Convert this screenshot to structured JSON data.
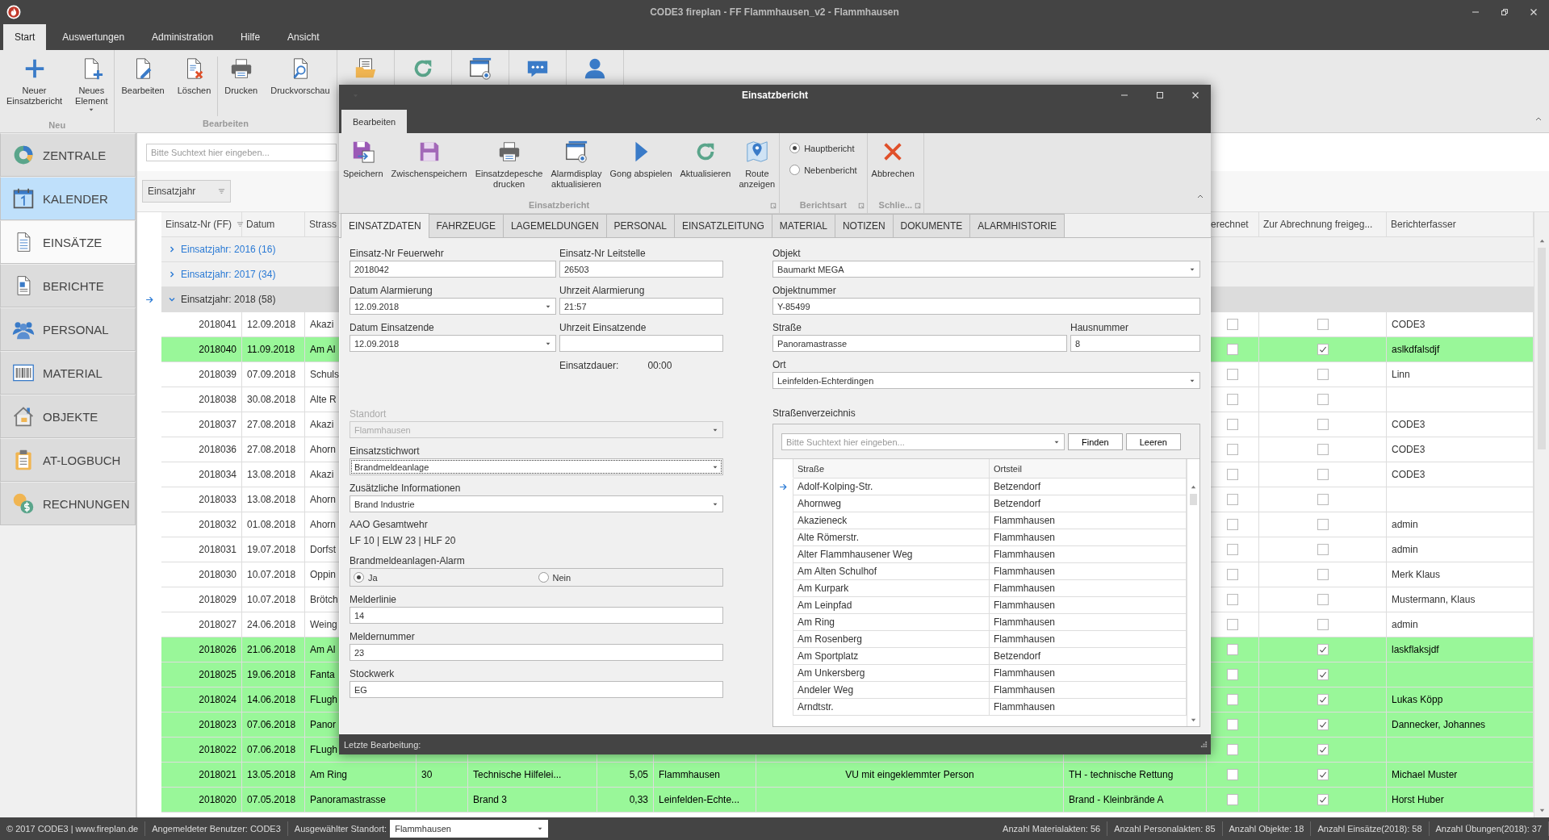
{
  "window": {
    "title": "CODE3 fireplan - FF Flammhausen_v2 - Flammhausen"
  },
  "menu_tabs": [
    {
      "label": "Start",
      "selected": true
    },
    {
      "label": "Auswertungen",
      "selected": false
    },
    {
      "label": "Administration",
      "selected": false
    },
    {
      "label": "Hilfe",
      "selected": false
    },
    {
      "label": "Ansicht",
      "selected": false
    }
  ],
  "ribbon": {
    "groups": [
      {
        "label": "Neu",
        "buttons": [
          {
            "label": "Neuer\nEinsatzbericht",
            "dropdown": false,
            "separator": false
          },
          {
            "label": "Neues\nElement",
            "dropdown": true,
            "separator": false
          }
        ]
      },
      {
        "label": "Bearbeiten",
        "buttons": [
          {
            "label": "Bearbeiten",
            "dropdown": false,
            "separator": false
          },
          {
            "label": "Löschen",
            "dropdown": false,
            "separator": false
          },
          {
            "label": "Drucken",
            "dropdown": false,
            "separator": true
          },
          {
            "label": "Druckvorschau",
            "dropdown": false,
            "separator": false
          }
        ]
      }
    ]
  },
  "sidebar": {
    "items": [
      {
        "label": "ZENTRALE",
        "selected": false,
        "hovered": false
      },
      {
        "label": "KALENDER",
        "selected": true,
        "hovered": false
      },
      {
        "label": "EINSÄTZE",
        "selected": false,
        "hovered": true
      },
      {
        "label": "BERICHTE",
        "selected": false,
        "hovered": false
      },
      {
        "label": "PERSONAL",
        "selected": false,
        "hovered": false
      },
      {
        "label": "MATERIAL",
        "selected": false,
        "hovered": false
      },
      {
        "label": "OBJEKTE",
        "selected": false,
        "hovered": false
      },
      {
        "label": "AT-LOGBUCH",
        "selected": false,
        "hovered": false
      },
      {
        "label": "RECHNUNGEN",
        "selected": false,
        "hovered": false
      }
    ]
  },
  "search": {
    "placeholder": "Bitte Suchtext hier eingeben..."
  },
  "group_panel": {
    "chip": "Einsatzjahr"
  },
  "table": {
    "columns": [
      "Einsatz-Nr (FF)",
      "Datum",
      "Strass"
    ],
    "right_columns": [
      "erechnet",
      "Zur Abrechnung freigeg...",
      "Berichterfasser"
    ],
    "groups": [
      {
        "label": "Einsatzjahr: 2016 (16)",
        "expanded": false,
        "current": false
      },
      {
        "label": "Einsatzjahr: 2017 (34)",
        "expanded": false,
        "current": false
      },
      {
        "label": "Einsatzjahr: 2018 (58)",
        "expanded": true,
        "current": true
      }
    ],
    "rows": [
      {
        "nr": "2018041",
        "datum": "12.09.2018",
        "strasse": "Akazi",
        "erechnet": false,
        "freigegeben": false,
        "berichterfasser": "CODE3"
      },
      {
        "nr": "2018040",
        "datum": "11.09.2018",
        "strasse": "Am Al",
        "erechnet": false,
        "freigegeben": true,
        "berichterfasser": "aslkdfalsdjf"
      },
      {
        "nr": "2018039",
        "datum": "07.09.2018",
        "strasse": "Schuls",
        "erechnet": false,
        "freigegeben": false,
        "berichterfasser": "Linn"
      },
      {
        "nr": "2018038",
        "datum": "30.08.2018",
        "strasse": "Alte R",
        "erechnet": false,
        "freigegeben": false
      },
      {
        "nr": "2018037",
        "datum": "27.08.2018",
        "strasse": "Akazi",
        "erechnet": false,
        "freigegeben": false,
        "berichterfasser": "CODE3"
      },
      {
        "nr": "2018036",
        "datum": "27.08.2018",
        "strasse": "Ahorn",
        "erechnet": false,
        "freigegeben": false,
        "berichterfasser": "CODE3"
      },
      {
        "nr": "2018034",
        "datum": "13.08.2018",
        "strasse": "Akazi",
        "erechnet": false,
        "freigegeben": false,
        "berichterfasser": "CODE3"
      },
      {
        "nr": "2018033",
        "datum": "13.08.2018",
        "strasse": "Ahorn",
        "erechnet": false,
        "freigegeben": false
      },
      {
        "nr": "2018032",
        "datum": "01.08.2018",
        "strasse": "Ahorn",
        "erechnet": false,
        "freigegeben": false,
        "berichterfasser": "admin"
      },
      {
        "nr": "2018031",
        "datum": "19.07.2018",
        "strasse": "Dorfst",
        "erechnet": false,
        "freigegeben": false,
        "berichterfasser": "admin"
      },
      {
        "nr": "2018030",
        "datum": "10.07.2018",
        "strasse": "Oppin",
        "erechnet": false,
        "freigegeben": false,
        "berichterfasser": "Merk Klaus"
      },
      {
        "nr": "2018029",
        "datum": "10.07.2018",
        "strasse": "Brötch",
        "erechnet": false,
        "freigegeben": false,
        "berichterfasser": "Mustermann, Klaus"
      },
      {
        "nr": "2018027",
        "datum": "24.06.2018",
        "strasse": "Weing",
        "erechnet": false,
        "freigegeben": false,
        "berichterfasser": "admin"
      },
      {
        "nr": "2018026",
        "datum": "21.06.2018",
        "strasse": "Am Al",
        "erechnet": false,
        "freigegeben": true,
        "berichterfasser": "laskflaksjdf"
      },
      {
        "nr": "2018025",
        "datum": "19.06.2018",
        "strasse": "Fanta",
        "erechnet": false,
        "freigegeben": true
      },
      {
        "nr": "2018024",
        "datum": "14.06.2018",
        "strasse": "FLugh",
        "erechnet": false,
        "freigegeben": true,
        "berichterfasser": "Lukas Köpp"
      },
      {
        "nr": "2018023",
        "datum": "07.06.2018",
        "strasse": "Panor",
        "erechnet": false,
        "freigegeben": true,
        "berichterfasser": "Dannecker, Johannes"
      },
      {
        "nr": "2018022",
        "datum": "07.06.2018",
        "strasse": "FLugh",
        "erechnet": false,
        "freigegeben": true
      },
      {
        "nr": "2018021",
        "datum": "13.05.2018",
        "strasse": "Am Ring",
        "column_4": "30",
        "column_5": "Technische Hilfelei...",
        "column_6": "5,05",
        "column_7": "Flammhausen",
        "column_8": "VU mit eingeklemmter Person",
        "column_9": "TH - technische Rettung",
        "erechnet": false,
        "freigegeben": true,
        "berichterfasser": "Michael Muster"
      },
      {
        "nr": "2018020",
        "datum": "07.05.2018",
        "strasse": "Panoramastrasse",
        "column_5": "Brand 3",
        "column_6": "0,33",
        "column_7": "Leinfelden-Echte...",
        "column_9": "Brand - Kleinbrände A",
        "erechnet": false,
        "freigegeben": true,
        "berichterfasser": "Horst Huber"
      }
    ]
  },
  "dialog": {
    "title": "Einsatzbericht",
    "ribbon_tab": "Bearbeiten",
    "groups": [
      {
        "kind": "buttons",
        "label": "Einsatzbericht",
        "buttons": [
          "Speichern",
          "Zwischenspeichern",
          "Einsatzdepesche\ndrucken",
          "Alarmdisplay\naktualisieren",
          "Gong abspielen",
          "Aktualisieren",
          "Route\nanzeigen"
        ]
      },
      {
        "kind": "radios",
        "label": "Berichtsart",
        "options": [
          {
            "label": "Hauptbericht",
            "selected": true
          },
          {
            "label": "Nebenbericht",
            "selected": false
          }
        ]
      },
      {
        "kind": "buttons",
        "label": "Schlie...",
        "buttons": [
          "Abbrechen"
        ]
      }
    ],
    "tabs": [
      {
        "label": "EINSATZDATEN",
        "selected": true
      },
      {
        "label": "FAHRZEUGE",
        "selected": false
      },
      {
        "label": "LAGEMELDUNGEN",
        "selected": false
      },
      {
        "label": "PERSONAL",
        "selected": false
      },
      {
        "label": "EINSATZLEITUNG",
        "selected": false
      },
      {
        "label": "MATERIAL",
        "selected": false
      },
      {
        "label": "NOTIZEN",
        "selected": false
      },
      {
        "label": "DOKUMENTE",
        "selected": false
      },
      {
        "label": "ALARMHISTORIE",
        "selected": false
      }
    ],
    "left": [
      {
        "kind": "fields",
        "fields": [
          {
            "label": "Einsatz-Nr Feuerwehr",
            "value": "2018042",
            "kind": "text",
            "disabled": false,
            "focused": false
          },
          {
            "label": "Einsatz-Nr Leitstelle",
            "value": "26503",
            "kind": "text",
            "disabled": false,
            "focused": false
          }
        ]
      },
      {
        "kind": "fields",
        "fields": [
          {
            "label": "Datum Alarmierung",
            "value": "12.09.2018",
            "kind": "dropdown",
            "disabled": false,
            "focused": false
          },
          {
            "label": "Uhrzeit Alarmierung",
            "value": "21:57",
            "kind": "text",
            "disabled": false,
            "focused": false
          }
        ]
      },
      {
        "kind": "fields",
        "fields": [
          {
            "label": "Datum Einsatzende",
            "value": "12.09.2018",
            "kind": "dropdown",
            "disabled": false,
            "focused": false
          },
          {
            "label": "Uhrzeit Einsatzende",
            "kind": "text",
            "disabled": false,
            "focused": false
          }
        ]
      },
      {
        "kind": "duration",
        "label": "Einsatzdauer:",
        "value": "00:00"
      },
      {
        "kind": "fields",
        "fields": [
          {
            "label": "Standort",
            "value": "Flammhausen",
            "kind": "dropdown",
            "disabled": true,
            "focused": false
          }
        ]
      },
      {
        "kind": "fields",
        "fields": [
          {
            "label": "Einsatzstichwort",
            "value": "Brandmeldeanlage",
            "kind": "dropdown",
            "disabled": false,
            "focused": true
          }
        ]
      },
      {
        "kind": "fields",
        "fields": [
          {
            "label": "Zusätzliche Informationen",
            "value": "Brand Industrie",
            "kind": "dropdown",
            "disabled": false,
            "focused": false
          }
        ]
      },
      {
        "kind": "static",
        "label": "AAO Gesamtwehr",
        "value": "LF 10 | ELW 23 | HLF 20"
      },
      {
        "kind": "radio",
        "label": "Brandmeldeanlagen-Alarm",
        "options": [
          {
            "label": "Ja",
            "selected": true
          },
          {
            "label": "Nein",
            "selected": false
          }
        ]
      },
      {
        "kind": "fields",
        "fields": [
          {
            "label": "Melderlinie",
            "value": "14",
            "kind": "text",
            "disabled": false,
            "focused": false
          }
        ]
      },
      {
        "kind": "fields",
        "fields": [
          {
            "label": "Meldernummer",
            "value": "23",
            "kind": "text",
            "disabled": false,
            "focused": false
          }
        ]
      },
      {
        "kind": "fields",
        "fields": [
          {
            "label": "Stockwerk",
            "value": "EG",
            "kind": "text",
            "disabled": false,
            "focused": false
          }
        ]
      }
    ],
    "right": [
      {
        "kind": "fields",
        "fields": [
          {
            "label": "Objekt",
            "value": "Baumarkt MEGA",
            "kind": "dropdown",
            "disabled": false,
            "focused": false
          }
        ]
      },
      {
        "kind": "fields",
        "fields": [
          {
            "label": "Objektnummer",
            "value": "Y-85499",
            "kind": "text",
            "disabled": false,
            "focused": false
          }
        ]
      },
      {
        "kind": "fields",
        "fields": [
          {
            "label": "Straße",
            "value": "Panoramastrasse",
            "kind": "text",
            "disabled": false,
            "focused": false
          },
          {
            "label": "Hausnummer",
            "value": "8",
            "kind": "text",
            "disabled": false,
            "focused": false
          }
        ]
      },
      {
        "kind": "fields",
        "fields": [
          {
            "label": "Ort",
            "value": "Leinfelden-Echterdingen",
            "kind": "dropdown",
            "disabled": false,
            "focused": false
          }
        ]
      }
    ],
    "street_directory": {
      "label": "Straßenverzeichnis",
      "placeholder": "Bitte Suchtext hier eingeben...",
      "buttons": [
        "Finden",
        "Leeren"
      ],
      "columns": [
        "Straße",
        "Ortsteil"
      ],
      "rows": [
        {
          "strasse": "Adolf-Kolping-Str.",
          "ortsteil": "Betzendorf",
          "current": true
        },
        {
          "strasse": "Ahornweg",
          "ortsteil": "Betzendorf",
          "current": false
        },
        {
          "strasse": "Akazieneck",
          "ortsteil": "Flammhausen",
          "current": false
        },
        {
          "strasse": "Alte Römerstr.",
          "ortsteil": "Flammhausen",
          "current": false
        },
        {
          "strasse": "Alter Flammhausener Weg",
          "ortsteil": "Flammhausen",
          "current": false
        },
        {
          "strasse": "Am Alten Schulhof",
          "ortsteil": "Flammhausen",
          "current": false
        },
        {
          "strasse": "Am Kurpark",
          "ortsteil": "Flammhausen",
          "current": false
        },
        {
          "strasse": "Am Leinpfad",
          "ortsteil": "Flammhausen",
          "current": false
        },
        {
          "strasse": "Am Ring",
          "ortsteil": "Flammhausen",
          "current": false
        },
        {
          "strasse": "Am Rosenberg",
          "ortsteil": "Flammhausen",
          "current": false
        },
        {
          "strasse": "Am Sportplatz",
          "ortsteil": "Betzendorf",
          "current": false
        },
        {
          "strasse": "Am Unkersberg",
          "ortsteil": "Flammhausen",
          "current": false
        },
        {
          "strasse": "Andeler Weg",
          "ortsteil": "Flammhausen",
          "current": false
        },
        {
          "strasse": "Arndtstr.",
          "ortsteil": "Flammhausen",
          "current": false
        }
      ]
    },
    "footer": "Letzte Bearbeitung:"
  },
  "status_bar": {
    "copyright": "© 2017 CODE3 | www.fireplan.de",
    "user": "Angemeldeter Benutzer: CODE3",
    "location_label": "Ausgewählter Standort:",
    "location": "Flammhausen",
    "counts": [
      "Anzahl Materialakten: 56",
      "Anzahl Personalakten: 85",
      "Anzahl Objekte: 18",
      "Anzahl Einsätze(2018): 58",
      "Anzahl Übungen(2018): 37"
    ]
  }
}
